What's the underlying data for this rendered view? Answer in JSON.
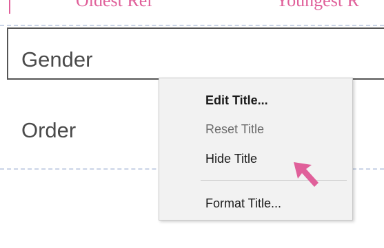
{
  "top_row": {
    "col1": "Oldest Rel",
    "col2": "Youngest R"
  },
  "fields": {
    "gender": "Gender",
    "order": "Order"
  },
  "context_menu": {
    "items": [
      {
        "label": "Edit Title...",
        "enabled": true,
        "default": true
      },
      {
        "label": "Reset Title",
        "enabled": false
      },
      {
        "label": "Hide Title",
        "enabled": true
      },
      {
        "label": "Format Title...",
        "enabled": true
      }
    ]
  },
  "colors": {
    "accent_pink": "#e0609a",
    "dash_line": "#c9d3e6",
    "menu_bg": "#f2f2f2",
    "disabled_text": "#6d6d6d"
  },
  "icons": {
    "pointer": "pointer-arrow-icon"
  }
}
